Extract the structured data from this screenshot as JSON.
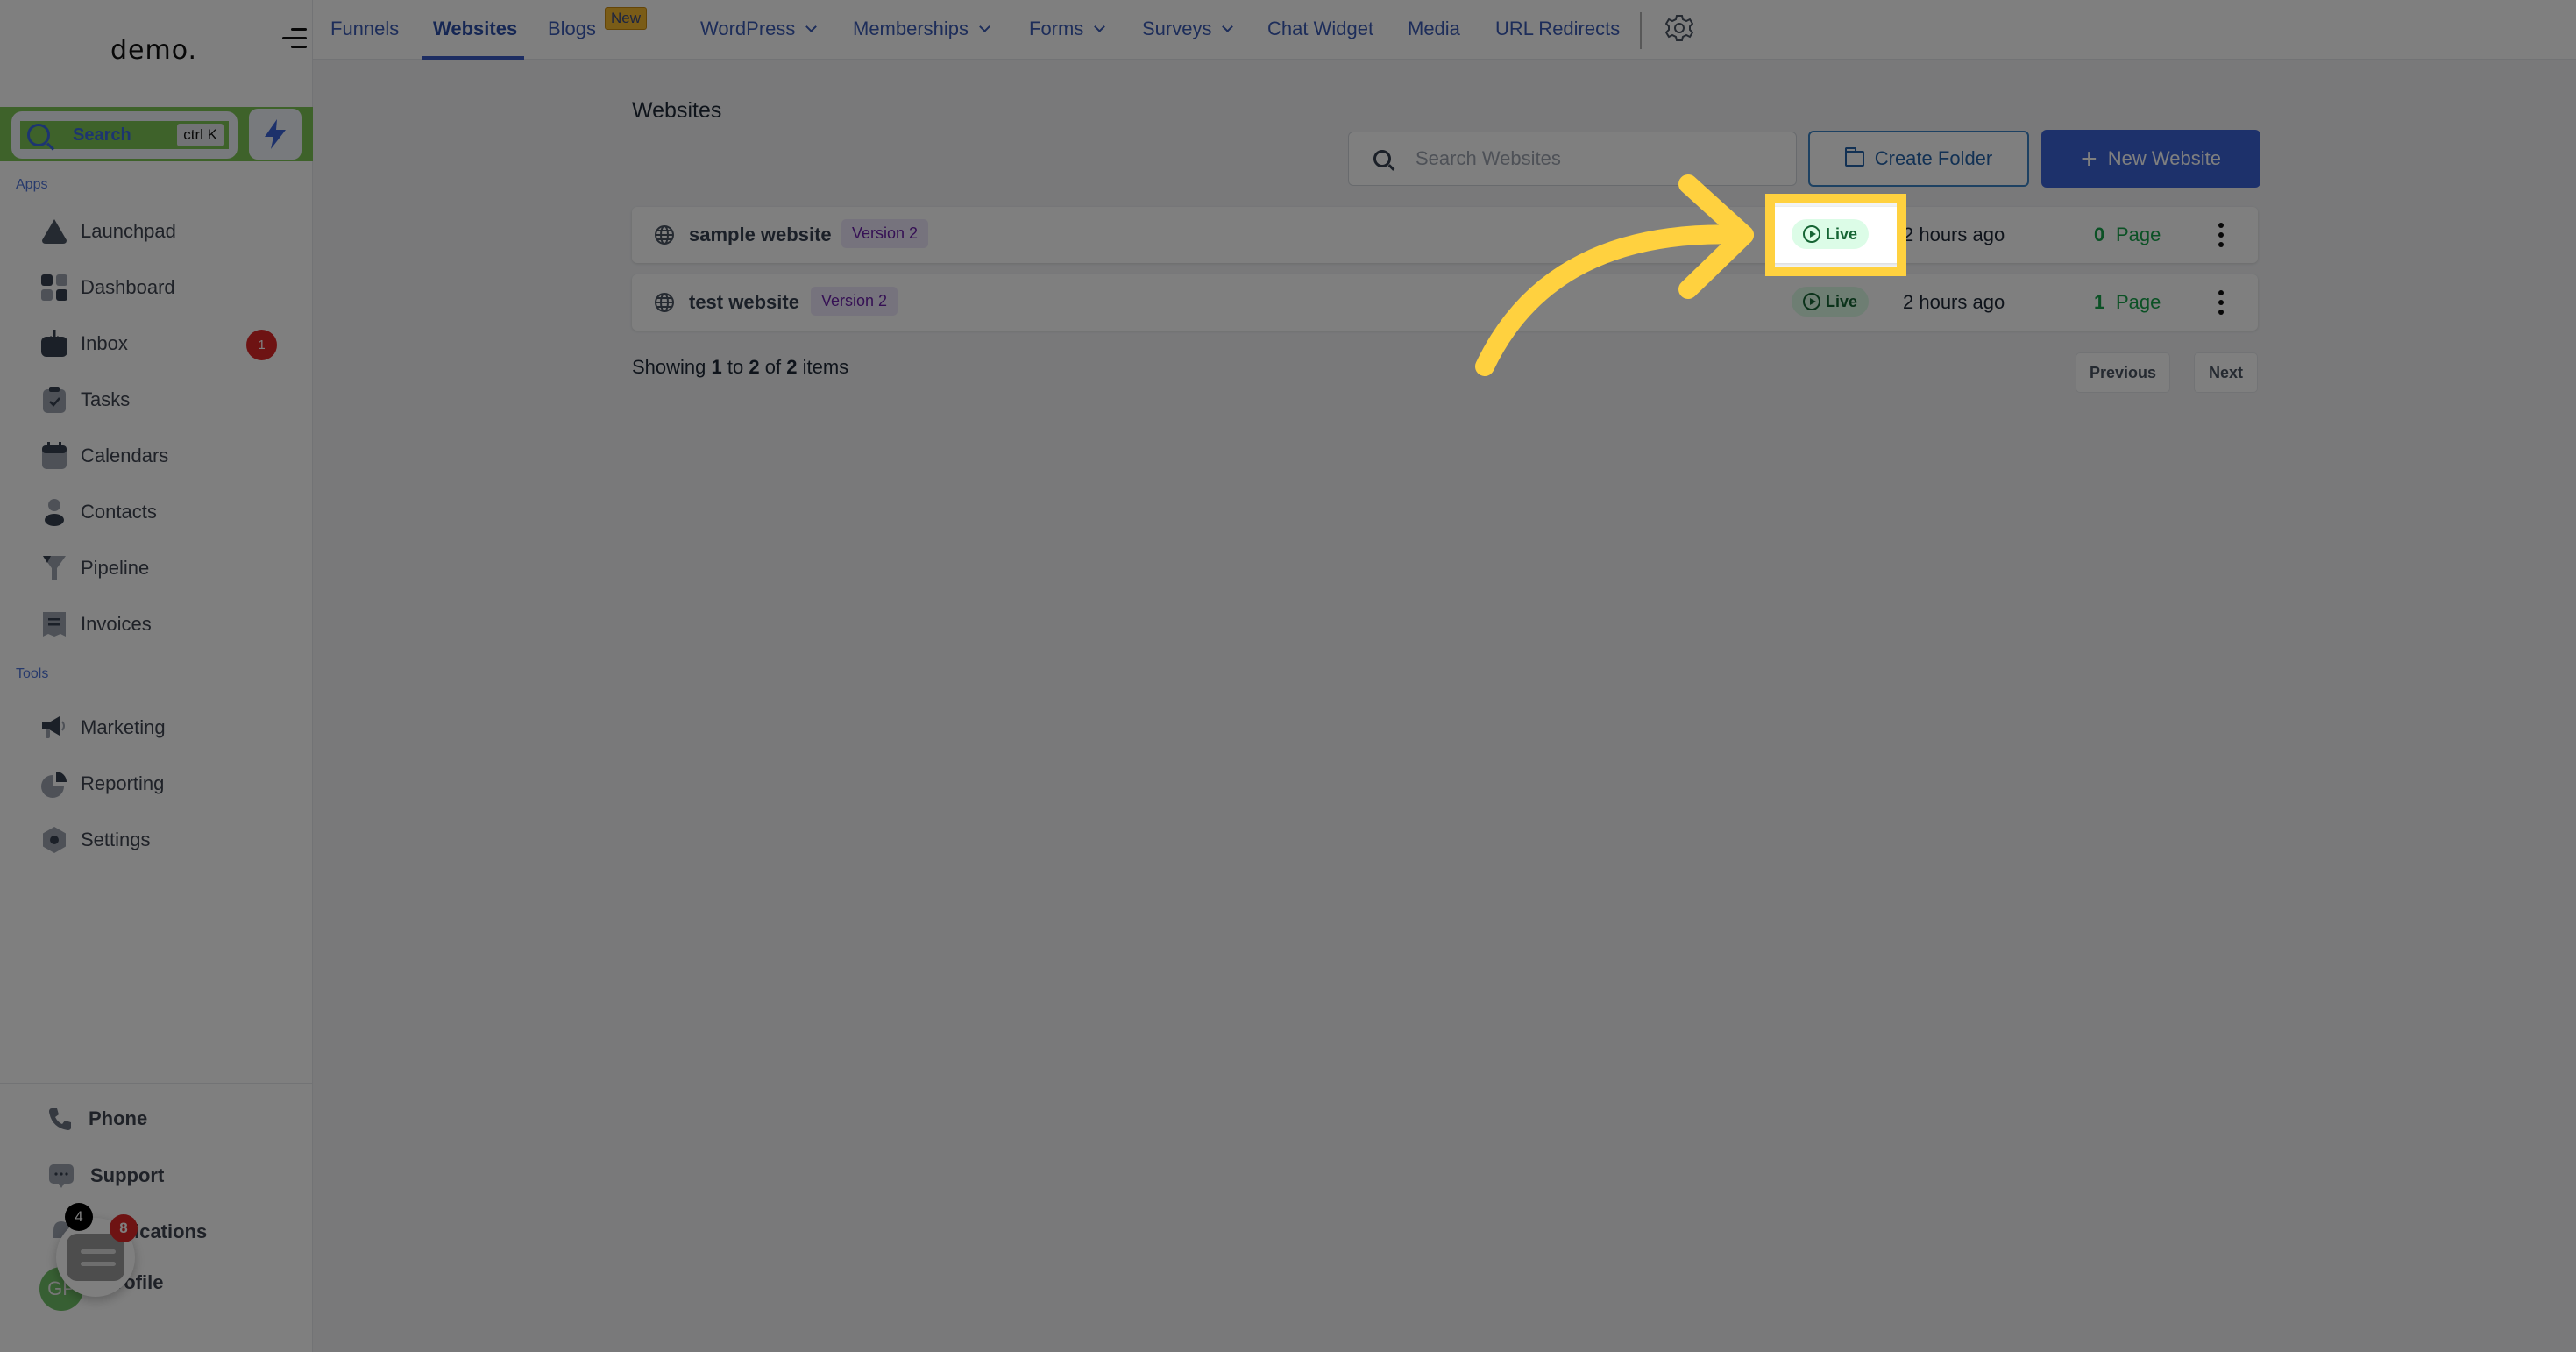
{
  "sidebar": {
    "logo": "demo.",
    "search": {
      "label": "Search",
      "shortcut": "ctrl K"
    },
    "sections": {
      "apps": "Apps",
      "tools": "Tools"
    },
    "apps": [
      {
        "label": "Launchpad",
        "icon": "launchpad-icon"
      },
      {
        "label": "Dashboard",
        "icon": "dashboard-icon"
      },
      {
        "label": "Inbox",
        "icon": "inbox-icon",
        "badge": "1"
      },
      {
        "label": "Tasks",
        "icon": "tasks-icon"
      },
      {
        "label": "Calendars",
        "icon": "calendar-icon"
      },
      {
        "label": "Contacts",
        "icon": "contacts-icon"
      },
      {
        "label": "Pipeline",
        "icon": "pipeline-icon"
      },
      {
        "label": "Invoices",
        "icon": "invoice-icon"
      }
    ],
    "tools": [
      {
        "label": "Marketing",
        "icon": "megaphone-icon"
      },
      {
        "label": "Reporting",
        "icon": "pie-chart-icon"
      },
      {
        "label": "Settings",
        "icon": "settings-icon"
      }
    ],
    "bottom": [
      {
        "label": "Phone",
        "icon": "phone-icon"
      },
      {
        "label": "Support",
        "icon": "support-chat-icon"
      },
      {
        "label": "Notifications",
        "icon": "bell-icon",
        "badge": "4"
      },
      {
        "label": "Profile",
        "avatar_initials": "GP"
      }
    ],
    "chat_widget_badge": "8"
  },
  "topnav": {
    "tabs": [
      {
        "label": "Funnels"
      },
      {
        "label": "Websites",
        "active": true
      },
      {
        "label": "Blogs",
        "badge": "New"
      },
      {
        "label": "WordPress",
        "dropdown": true
      },
      {
        "label": "Memberships",
        "dropdown": true
      },
      {
        "label": "Forms",
        "dropdown": true
      },
      {
        "label": "Surveys",
        "dropdown": true
      },
      {
        "label": "Chat Widget"
      },
      {
        "label": "Media"
      },
      {
        "label": "URL Redirects"
      }
    ]
  },
  "main": {
    "title": "Websites",
    "search_placeholder": "Search Websites",
    "search_value": "",
    "create_folder_label": "Create Folder",
    "new_website_label": "New Website",
    "websites": [
      {
        "name": "sample website",
        "version": "Version 2",
        "status": "Live",
        "updated": "2 hours ago",
        "page_count": "0",
        "page_label": "Page"
      },
      {
        "name": "test website",
        "version": "Version 2",
        "status": "Live",
        "updated": "2 hours ago",
        "page_count": "1",
        "page_label": "Page"
      }
    ],
    "pagination": {
      "showing_prefix": "Showing",
      "from": "1",
      "to_word": "to",
      "to": "2",
      "of_word": "of",
      "total": "2",
      "suffix": "items",
      "previous_label": "Previous",
      "next_label": "Next"
    }
  },
  "highlight": {
    "target": "Live status badge (sample website)",
    "color": "#ffd13f"
  },
  "colors": {
    "accent": "#3b63d6",
    "live_green": "#166534",
    "version_purple": "#6b21a8",
    "badge_red": "#dc2626"
  }
}
